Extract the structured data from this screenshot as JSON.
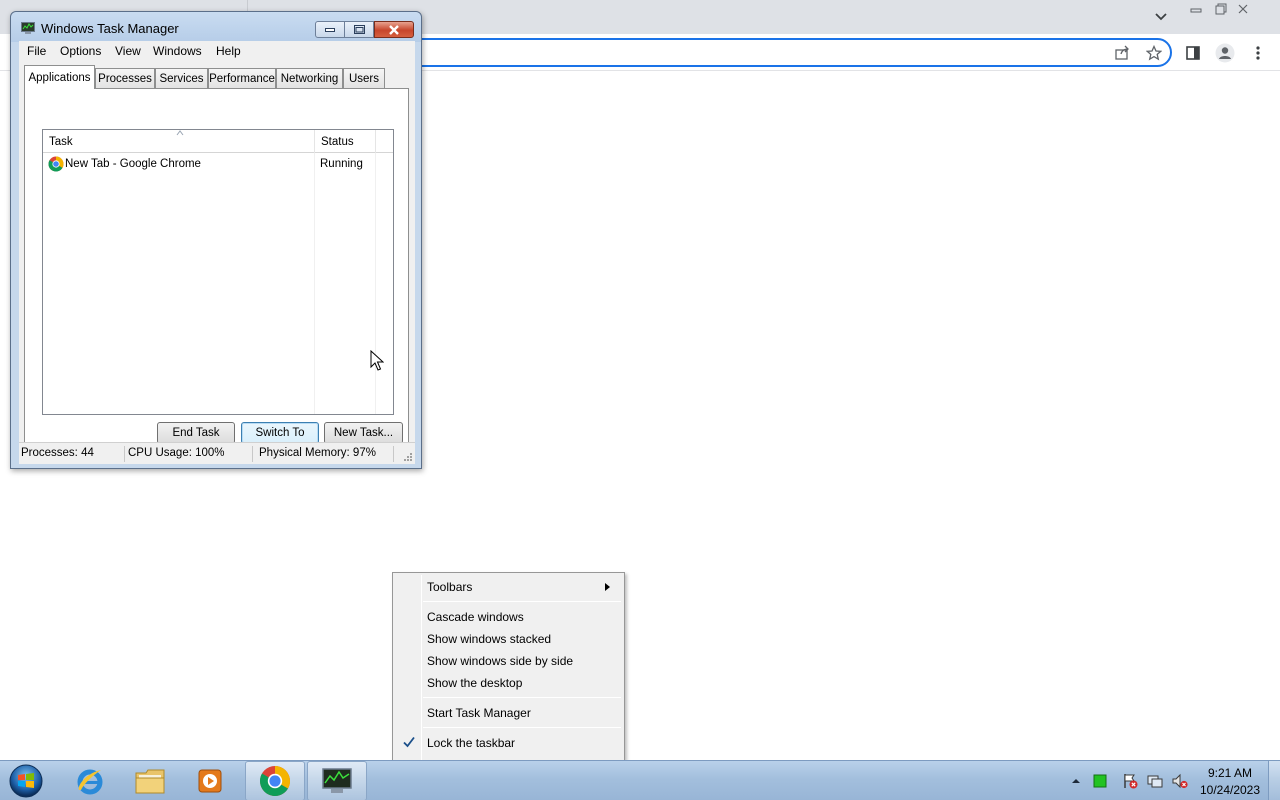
{
  "task_manager": {
    "title": "Windows Task Manager",
    "menu": [
      "File",
      "Options",
      "View",
      "Windows",
      "Help"
    ],
    "tabs": [
      "Applications",
      "Processes",
      "Services",
      "Performance",
      "Networking",
      "Users"
    ],
    "active_tab": "Applications",
    "columns": {
      "task": "Task",
      "status": "Status"
    },
    "rows": [
      {
        "task": "New Tab - Google Chrome",
        "status": "Running",
        "icon": "chrome-icon"
      }
    ],
    "buttons": {
      "end_task": "End Task",
      "switch_to": "Switch To",
      "new_task": "New Task..."
    },
    "status_bar": {
      "processes": "Processes: 44",
      "cpu": "CPU Usage: 100%",
      "memory": "Physical Memory: 97%"
    }
  },
  "context_menu": {
    "items": [
      {
        "label": "Toolbars",
        "submenu": true
      },
      {
        "label": "Cascade windows"
      },
      {
        "label": "Show windows stacked"
      },
      {
        "label": "Show windows side by side"
      },
      {
        "label": "Show the desktop"
      },
      {
        "label": "Start Task Manager"
      },
      {
        "label": "Lock the taskbar",
        "checked": true
      }
    ]
  },
  "taskbar": {
    "pinned": [
      "start-orb",
      "internet-explorer-icon",
      "windows-explorer-icon",
      "media-player-icon",
      "chrome-icon",
      "task-manager-icon"
    ],
    "clock": {
      "time": "9:21 AM",
      "date": "10/24/2023"
    }
  },
  "colors": {
    "window_frame": "#c6d8ec",
    "taskbar": "#a3bfdd",
    "omnibox_focus": "#1a73e8",
    "close_button": "#c7462c"
  }
}
